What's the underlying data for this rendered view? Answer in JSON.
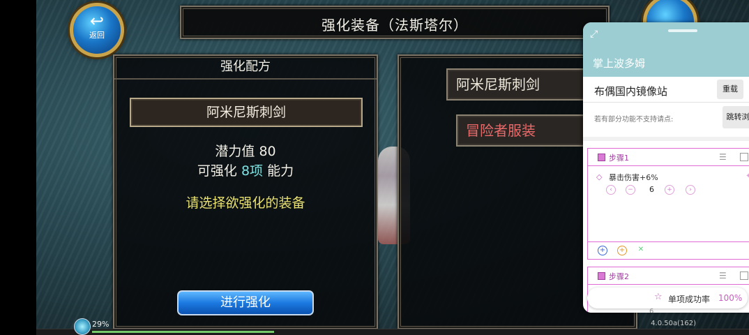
{
  "hud": {
    "back_label": "返回",
    "back_arrow": "↩",
    "title": "强化装备（法斯塔尔）"
  },
  "recipe_panel": {
    "header": "强化配方",
    "item_name": "阿米尼斯刺剑",
    "potential_label": "潜力值",
    "potential_value": "80",
    "enhance_label": "可强化",
    "enhance_count": "8项",
    "enhance_suffix": "能力",
    "prompt": "请选择欲强化的装备",
    "action_button": "进行强化"
  },
  "equipment_panel": {
    "items": [
      {
        "label": "阿米尼斯刺剑",
        "color": "#eee8da"
      },
      {
        "label": "冒险者服装",
        "color": "#e86a6a"
      }
    ]
  },
  "status_bar": {
    "load_percent": "29%",
    "version": "4.0.50a(162)"
  },
  "overlay": {
    "title": "掌上波多姆",
    "mirror_label": "布偶国内镜像站",
    "reload_button": "重载",
    "hint": "若有部分功能不支持请点:",
    "jump_button": "跳转浏",
    "steps": [
      {
        "title": "步骤1",
        "item_label": "暴击伤害+6%",
        "value": "6"
      },
      {
        "title": "步骤2",
        "value": "6"
      }
    ],
    "success_label": "单项成功率",
    "success_rate": "100%",
    "accent_color": "#c45fbd",
    "header_color": "#9ccdd2"
  }
}
